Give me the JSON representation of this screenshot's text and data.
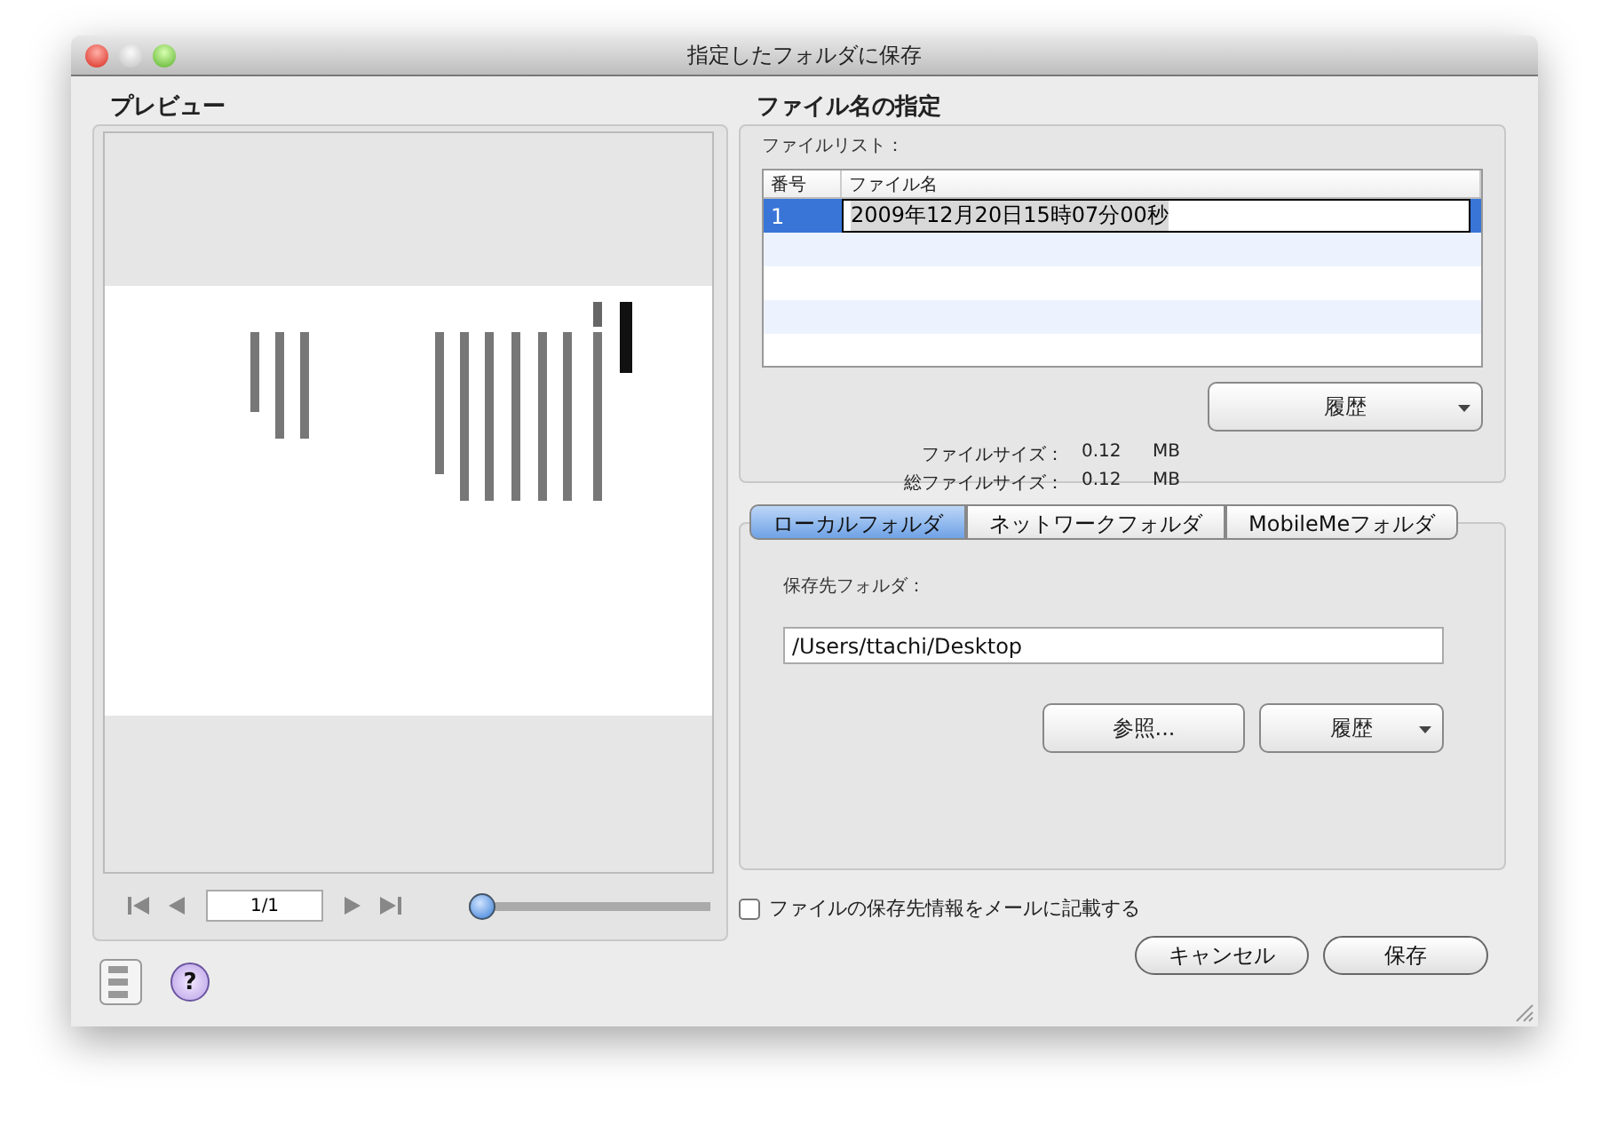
{
  "window": {
    "title": "指定したフォルダに保存"
  },
  "preview": {
    "title": "プレビュー",
    "page_field": "1/1",
    "zoom": {
      "level": 0
    }
  },
  "file_name": {
    "title": "ファイル名の指定",
    "list_label": "ファイルリスト：",
    "columns": [
      "番号",
      "ファイル名"
    ],
    "rows": [
      {
        "number": "1",
        "name": "2009年12月20日15時07分00秒",
        "selected": true
      }
    ],
    "history_button": "履歴",
    "sizes": [
      {
        "label": "ファイルサイズ：",
        "value": "0.12",
        "unit": "MB"
      },
      {
        "label": "総ファイルサイズ：",
        "value": "0.12",
        "unit": "MB"
      }
    ]
  },
  "destination": {
    "tabs": [
      {
        "label": "ローカルフォルダ",
        "selected": true
      },
      {
        "label": "ネットワークフォルダ",
        "selected": false
      },
      {
        "label": "MobileMeフォルダ",
        "selected": false
      }
    ],
    "folder_label": "保存先フォルダ：",
    "folder_path": "/Users/ttachi/Desktop",
    "browse_button": "参照...",
    "history_button": "履歴"
  },
  "mail_option": {
    "label": "ファイルの保存先情報をメールに記載する",
    "checked": false
  },
  "help_button": "?",
  "buttons": [
    "キャンセル",
    "保存"
  ]
}
